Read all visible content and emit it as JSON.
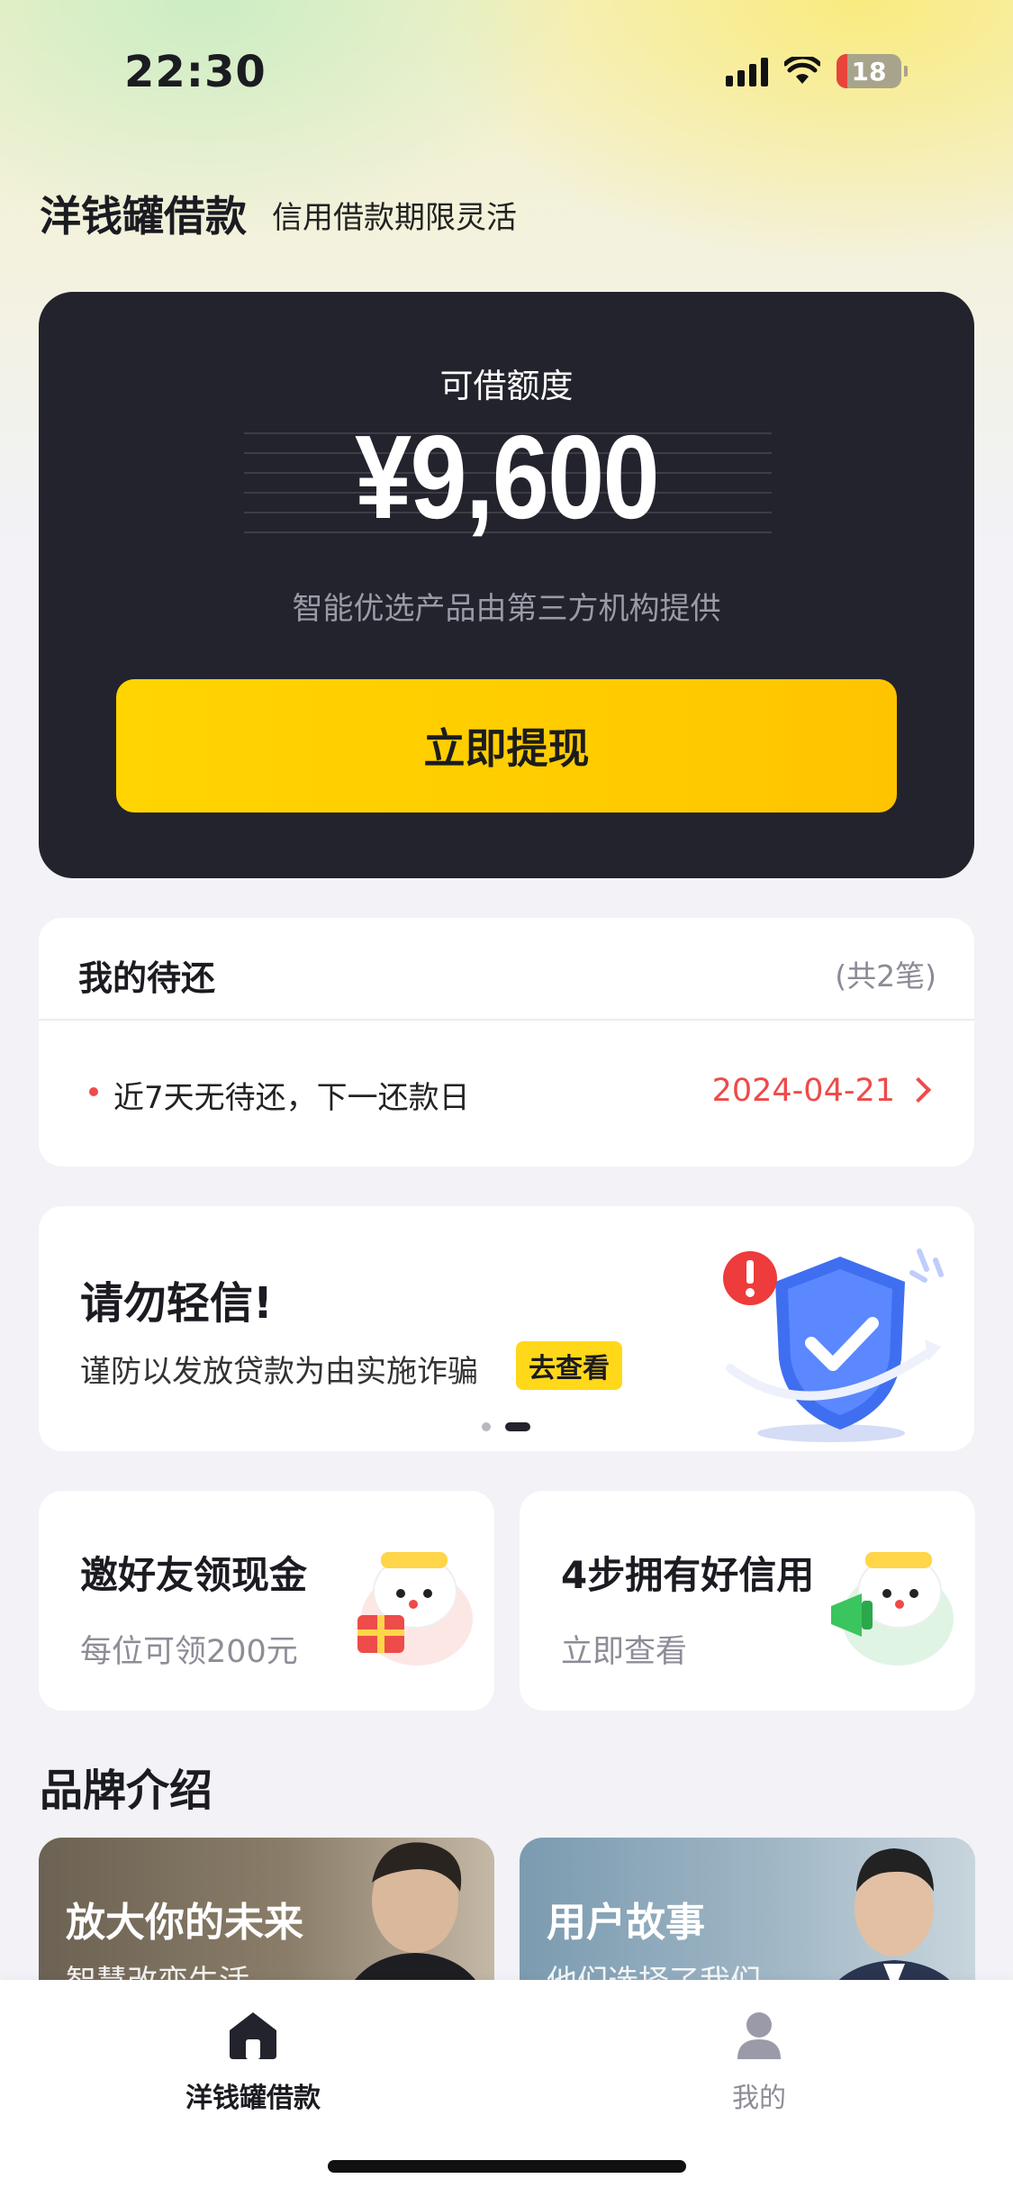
{
  "status_bar": {
    "time": "22:30",
    "battery": "18"
  },
  "header": {
    "title": "洋钱罐借款",
    "subtitle": "信用借款期限灵活"
  },
  "credit": {
    "label": "可借额度",
    "amount": "¥9,600",
    "note": "智能优选产品由第三方机构提供",
    "button": "立即提现"
  },
  "repayment": {
    "title": "我的待还",
    "count": "(共2笔)",
    "message": "近7天无待还，下一还款日",
    "next_date": "2024-04-21"
  },
  "banner": {
    "title": "请勿轻信!",
    "text": "谨防以发放贷款为由实施诈骗",
    "button": "去查看",
    "pages": 2,
    "active_page": 2
  },
  "promos": [
    {
      "title": "邀好友领现金",
      "subtitle": "每位可领200元"
    },
    {
      "title": "4步拥有好信用",
      "subtitle": "立即查看"
    }
  ],
  "brand": {
    "title": "品牌介绍",
    "cards": [
      {
        "title": "放大你的未来",
        "subtitle": "智慧改变生活"
      },
      {
        "title": "用户故事",
        "subtitle": "他们选择了我们"
      }
    ]
  },
  "tabbar": {
    "tabs": [
      {
        "label": "洋钱罐借款",
        "icon": "home-icon",
        "active": true
      },
      {
        "label": "我的",
        "icon": "user-icon",
        "active": false
      }
    ]
  },
  "colors": {
    "accent": "#ffd400",
    "dark_card": "#23232d",
    "alert_red": "#ef4a4a"
  }
}
